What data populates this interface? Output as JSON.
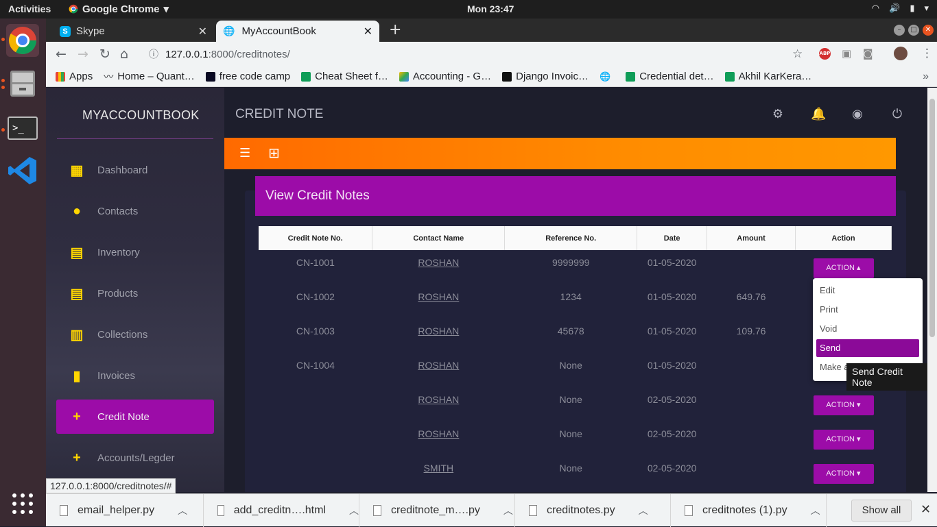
{
  "system": {
    "activities": "Activities",
    "app_menu": "Google Chrome",
    "clock": "Mon 23:47"
  },
  "browser": {
    "tabs": [
      {
        "label": "Skype"
      },
      {
        "label": "MyAccountBook"
      }
    ],
    "url_host": "127.0.0.1",
    "url_rest": ":8000/creditnotes/",
    "bookmarks": [
      "Apps",
      "Home – Quant…",
      "free code camp",
      "Cheat Sheet f…",
      "Accounting - G…",
      "Django Invoic…",
      "",
      "Credential det…",
      "Akhil KarKera…"
    ],
    "status_url": "127.0.0.1:8000/creditnotes/#"
  },
  "app": {
    "brand": "MYACCOUNTBOOK",
    "header_title": "CREDIT NOTE",
    "nav": [
      {
        "label": "Dashboard",
        "icon": "dashboard-icon"
      },
      {
        "label": "Contacts",
        "icon": "person-icon"
      },
      {
        "label": "Inventory",
        "icon": "inventory-icon"
      },
      {
        "label": "Products",
        "icon": "products-icon"
      },
      {
        "label": "Collections",
        "icon": "collections-icon"
      },
      {
        "label": "Invoices",
        "icon": "invoices-icon"
      },
      {
        "label": "Credit Note",
        "icon": "plus-icon",
        "active": true
      },
      {
        "label": "Accounts/Legder",
        "icon": "plus-icon"
      }
    ],
    "card_title": "View Credit Notes",
    "table": {
      "headers": [
        "Credit Note No.",
        "Contact Name",
        "Reference No.",
        "Date",
        "Amount",
        "Action"
      ],
      "rows": [
        {
          "no": "CN-1001",
          "contact": "ROSHAN",
          "ref": "9999999",
          "date": "01-05-2020",
          "amount": "",
          "action": "ACTION"
        },
        {
          "no": "CN-1002",
          "contact": "ROSHAN",
          "ref": "1234",
          "date": "01-05-2020",
          "amount": "649.76",
          "action": ""
        },
        {
          "no": "CN-1003",
          "contact": "ROSHAN",
          "ref": "45678",
          "date": "01-05-2020",
          "amount": "109.76",
          "action": ""
        },
        {
          "no": "CN-1004",
          "contact": "ROSHAN",
          "ref": "None",
          "date": "01-05-2020",
          "amount": "",
          "action": ""
        },
        {
          "no": "",
          "contact": "ROSHAN",
          "ref": "None",
          "date": "02-05-2020",
          "amount": "",
          "action": "ACTION"
        },
        {
          "no": "",
          "contact": "ROSHAN",
          "ref": "None",
          "date": "02-05-2020",
          "amount": "",
          "action": "ACTION"
        },
        {
          "no": "",
          "contact": "SMITH",
          "ref": "None",
          "date": "02-05-2020",
          "amount": "",
          "action": "ACTION"
        }
      ]
    },
    "dropdown": [
      "Edit",
      "Print",
      "Void",
      "Send",
      "Make a"
    ],
    "tooltip": "Send Credit Note",
    "accent": "#9c0ca8",
    "toolbar_color": "#ff7a00"
  },
  "downloads": {
    "items": [
      "email_helper.py",
      "add_creditn….html",
      "creditnote_m….py",
      "creditnotes.py",
      "creditnotes (1).py"
    ],
    "show_all": "Show all"
  }
}
